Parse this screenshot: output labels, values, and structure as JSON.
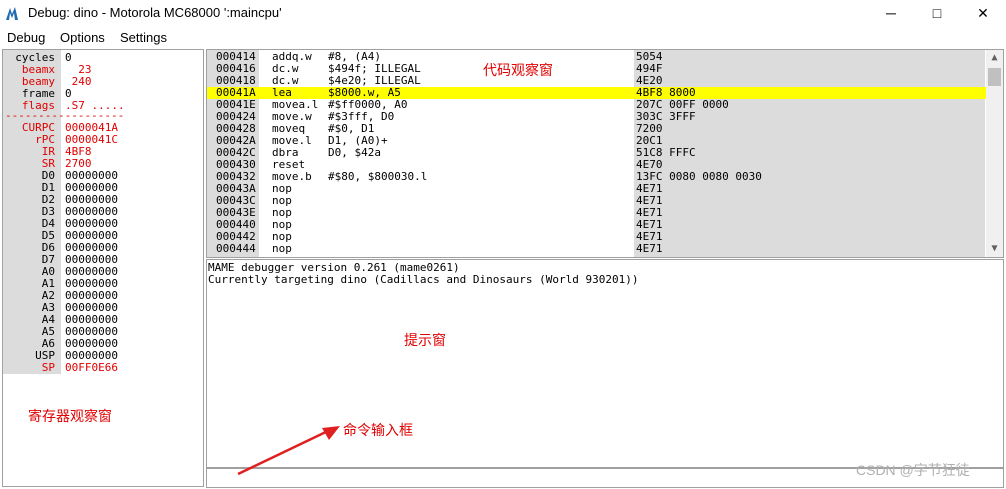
{
  "window": {
    "title": "Debug: dino - Motorola MC68000 ':maincpu'",
    "minimize": "─",
    "maximize": "□",
    "close": "✕"
  },
  "menu": [
    "Debug",
    "Options",
    "Settings"
  ],
  "registers": [
    {
      "name": "cycles",
      "value": "0",
      "red": false
    },
    {
      "name": "beamx",
      "value": "  23",
      "red": true
    },
    {
      "name": "beamy",
      "value": " 240",
      "red": true
    },
    {
      "name": "frame",
      "value": "0",
      "red": false
    },
    {
      "name": "flags",
      "value": ".S7 .....",
      "red": true
    }
  ],
  "registers2": [
    {
      "name": "CURPC",
      "value": "0000041A"
    },
    {
      "name": "rPC",
      "value": "0000041C"
    },
    {
      "name": "IR",
      "value": "4BF8"
    },
    {
      "name": "SR",
      "value": "2700"
    },
    {
      "name": "D0",
      "value": "00000000"
    },
    {
      "name": "D1",
      "value": "00000000"
    },
    {
      "name": "D2",
      "value": "00000000"
    },
    {
      "name": "D3",
      "value": "00000000"
    },
    {
      "name": "D4",
      "value": "00000000"
    },
    {
      "name": "D5",
      "value": "00000000"
    },
    {
      "name": "D6",
      "value": "00000000"
    },
    {
      "name": "D7",
      "value": "00000000"
    },
    {
      "name": "A0",
      "value": "00000000"
    },
    {
      "name": "A1",
      "value": "00000000"
    },
    {
      "name": "A2",
      "value": "00000000"
    },
    {
      "name": "A3",
      "value": "00000000"
    },
    {
      "name": "A4",
      "value": "00000000"
    },
    {
      "name": "A5",
      "value": "00000000"
    },
    {
      "name": "A6",
      "value": "00000000"
    },
    {
      "name": "USP",
      "value": "00000000"
    },
    {
      "name": "SP",
      "value": "00FF0E66"
    }
  ],
  "reg_separator": "------------------",
  "code": [
    {
      "addr": "000414",
      "mn": "addq.w",
      "op": "#8, (A4)",
      "bytes": "5054"
    },
    {
      "addr": "000416",
      "mn": "dc.w",
      "op": "$494f; ILLEGAL",
      "bytes": "494F"
    },
    {
      "addr": "000418",
      "mn": "dc.w",
      "op": "$4e20; ILLEGAL",
      "bytes": "4E20"
    },
    {
      "addr": "00041A",
      "mn": "lea",
      "op": "$8000.w, A5",
      "bytes": "4BF8 8000"
    },
    {
      "addr": "00041E",
      "mn": "movea.l",
      "op": "#$ff0000, A0",
      "bytes": "207C 00FF 0000"
    },
    {
      "addr": "000424",
      "mn": "move.w",
      "op": "#$3fff, D0",
      "bytes": "303C 3FFF"
    },
    {
      "addr": "000428",
      "mn": "moveq",
      "op": "#$0, D1",
      "bytes": "7200"
    },
    {
      "addr": "00042A",
      "mn": "move.l",
      "op": "D1, (A0)+",
      "bytes": "20C1"
    },
    {
      "addr": "00042C",
      "mn": "dbra",
      "op": "D0, $42a",
      "bytes": "51C8 FFFC"
    },
    {
      "addr": "000430",
      "mn": "reset",
      "op": "",
      "bytes": "4E70"
    },
    {
      "addr": "000432",
      "mn": "move.b",
      "op": "#$80, $800030.l",
      "bytes": "13FC 0080 0080 0030"
    },
    {
      "addr": "00043A",
      "mn": "nop",
      "op": "",
      "bytes": "4E71"
    },
    {
      "addr": "00043C",
      "mn": "nop",
      "op": "",
      "bytes": "4E71"
    },
    {
      "addr": "00043E",
      "mn": "nop",
      "op": "",
      "bytes": "4E71"
    },
    {
      "addr": "000440",
      "mn": "nop",
      "op": "",
      "bytes": "4E71"
    },
    {
      "addr": "000442",
      "mn": "nop",
      "op": "",
      "bytes": "4E71"
    },
    {
      "addr": "000444",
      "mn": "nop",
      "op": "",
      "bytes": "4E71"
    }
  ],
  "highlight_addr": "00041A",
  "highlight_color": "#ffff00",
  "console": [
    "MAME debugger version 0.261 (mame0261)",
    "Currently targeting dino (Cadillacs and Dinosaurs (World 930201))"
  ],
  "scroll": {
    "up": "▲",
    "down": "▼"
  },
  "annotations": {
    "code_window": "代码观察窗",
    "prompt_window": "提示窗",
    "register_window": "寄存器观察窗",
    "command_input": "命令输入框"
  },
  "watermark": "CSDN @字节狂徒",
  "colors": {
    "accent_red": "#e00000",
    "arrow_red": "#e02020"
  }
}
